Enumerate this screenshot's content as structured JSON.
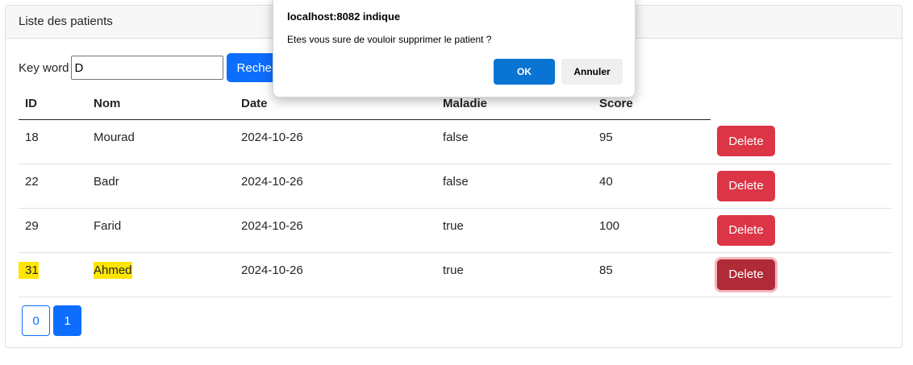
{
  "card": {
    "header_title": "Liste des patients"
  },
  "search": {
    "label": "Key word",
    "value": "D",
    "button_label": "Rechercher"
  },
  "table": {
    "headers": {
      "id": "ID",
      "nom": "Nom",
      "date": "Date",
      "maladie": "Maladie",
      "score": "Score"
    },
    "rows": [
      {
        "id": "18",
        "nom": "Mourad",
        "date": "2024-10-26",
        "maladie": "false",
        "score": "95",
        "action": "Delete"
      },
      {
        "id": "22",
        "nom": "Badr",
        "date": "2024-10-26",
        "maladie": "false",
        "score": "40",
        "action": "Delete"
      },
      {
        "id": "29",
        "nom": "Farid",
        "date": "2024-10-26",
        "maladie": "true",
        "score": "100",
        "action": "Delete"
      },
      {
        "id": "31",
        "nom": "Ahmed",
        "date": "2024-10-26",
        "maladie": "true",
        "score": "85",
        "action": "Delete"
      }
    ]
  },
  "pagination": {
    "pages": [
      "0",
      "1"
    ],
    "active_page": "1"
  },
  "dialog": {
    "title": "localhost:8082 indique",
    "message": "Etes vous sure de vouloir supprimer le patient ?",
    "ok_label": "OK",
    "cancel_label": "Annuler"
  },
  "colors": {
    "primary": "#0d6efd",
    "danger": "#dc3545",
    "danger_active": "#b02a37",
    "highlight": "#ffe500",
    "dialog_ok": "#0a74d4"
  }
}
